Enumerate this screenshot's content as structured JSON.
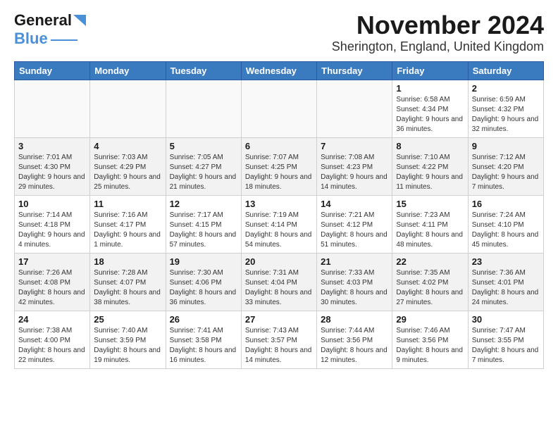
{
  "header": {
    "logo": {
      "line1": "General",
      "line2": "Blue"
    },
    "title": "November 2024",
    "subtitle": "Sherington, England, United Kingdom"
  },
  "calendar": {
    "weekdays": [
      "Sunday",
      "Monday",
      "Tuesday",
      "Wednesday",
      "Thursday",
      "Friday",
      "Saturday"
    ],
    "weeks": [
      [
        {
          "day": "",
          "info": ""
        },
        {
          "day": "",
          "info": ""
        },
        {
          "day": "",
          "info": ""
        },
        {
          "day": "",
          "info": ""
        },
        {
          "day": "",
          "info": ""
        },
        {
          "day": "1",
          "info": "Sunrise: 6:58 AM\nSunset: 4:34 PM\nDaylight: 9 hours and 36 minutes."
        },
        {
          "day": "2",
          "info": "Sunrise: 6:59 AM\nSunset: 4:32 PM\nDaylight: 9 hours and 32 minutes."
        }
      ],
      [
        {
          "day": "3",
          "info": "Sunrise: 7:01 AM\nSunset: 4:30 PM\nDaylight: 9 hours and 29 minutes."
        },
        {
          "day": "4",
          "info": "Sunrise: 7:03 AM\nSunset: 4:29 PM\nDaylight: 9 hours and 25 minutes."
        },
        {
          "day": "5",
          "info": "Sunrise: 7:05 AM\nSunset: 4:27 PM\nDaylight: 9 hours and 21 minutes."
        },
        {
          "day": "6",
          "info": "Sunrise: 7:07 AM\nSunset: 4:25 PM\nDaylight: 9 hours and 18 minutes."
        },
        {
          "day": "7",
          "info": "Sunrise: 7:08 AM\nSunset: 4:23 PM\nDaylight: 9 hours and 14 minutes."
        },
        {
          "day": "8",
          "info": "Sunrise: 7:10 AM\nSunset: 4:22 PM\nDaylight: 9 hours and 11 minutes."
        },
        {
          "day": "9",
          "info": "Sunrise: 7:12 AM\nSunset: 4:20 PM\nDaylight: 9 hours and 7 minutes."
        }
      ],
      [
        {
          "day": "10",
          "info": "Sunrise: 7:14 AM\nSunset: 4:18 PM\nDaylight: 9 hours and 4 minutes."
        },
        {
          "day": "11",
          "info": "Sunrise: 7:16 AM\nSunset: 4:17 PM\nDaylight: 9 hours and 1 minute."
        },
        {
          "day": "12",
          "info": "Sunrise: 7:17 AM\nSunset: 4:15 PM\nDaylight: 8 hours and 57 minutes."
        },
        {
          "day": "13",
          "info": "Sunrise: 7:19 AM\nSunset: 4:14 PM\nDaylight: 8 hours and 54 minutes."
        },
        {
          "day": "14",
          "info": "Sunrise: 7:21 AM\nSunset: 4:12 PM\nDaylight: 8 hours and 51 minutes."
        },
        {
          "day": "15",
          "info": "Sunrise: 7:23 AM\nSunset: 4:11 PM\nDaylight: 8 hours and 48 minutes."
        },
        {
          "day": "16",
          "info": "Sunrise: 7:24 AM\nSunset: 4:10 PM\nDaylight: 8 hours and 45 minutes."
        }
      ],
      [
        {
          "day": "17",
          "info": "Sunrise: 7:26 AM\nSunset: 4:08 PM\nDaylight: 8 hours and 42 minutes."
        },
        {
          "day": "18",
          "info": "Sunrise: 7:28 AM\nSunset: 4:07 PM\nDaylight: 8 hours and 38 minutes."
        },
        {
          "day": "19",
          "info": "Sunrise: 7:30 AM\nSunset: 4:06 PM\nDaylight: 8 hours and 36 minutes."
        },
        {
          "day": "20",
          "info": "Sunrise: 7:31 AM\nSunset: 4:04 PM\nDaylight: 8 hours and 33 minutes."
        },
        {
          "day": "21",
          "info": "Sunrise: 7:33 AM\nSunset: 4:03 PM\nDaylight: 8 hours and 30 minutes."
        },
        {
          "day": "22",
          "info": "Sunrise: 7:35 AM\nSunset: 4:02 PM\nDaylight: 8 hours and 27 minutes."
        },
        {
          "day": "23",
          "info": "Sunrise: 7:36 AM\nSunset: 4:01 PM\nDaylight: 8 hours and 24 minutes."
        }
      ],
      [
        {
          "day": "24",
          "info": "Sunrise: 7:38 AM\nSunset: 4:00 PM\nDaylight: 8 hours and 22 minutes."
        },
        {
          "day": "25",
          "info": "Sunrise: 7:40 AM\nSunset: 3:59 PM\nDaylight: 8 hours and 19 minutes."
        },
        {
          "day": "26",
          "info": "Sunrise: 7:41 AM\nSunset: 3:58 PM\nDaylight: 8 hours and 16 minutes."
        },
        {
          "day": "27",
          "info": "Sunrise: 7:43 AM\nSunset: 3:57 PM\nDaylight: 8 hours and 14 minutes."
        },
        {
          "day": "28",
          "info": "Sunrise: 7:44 AM\nSunset: 3:56 PM\nDaylight: 8 hours and 12 minutes."
        },
        {
          "day": "29",
          "info": "Sunrise: 7:46 AM\nSunset: 3:56 PM\nDaylight: 8 hours and 9 minutes."
        },
        {
          "day": "30",
          "info": "Sunrise: 7:47 AM\nSunset: 3:55 PM\nDaylight: 8 hours and 7 minutes."
        }
      ]
    ]
  }
}
